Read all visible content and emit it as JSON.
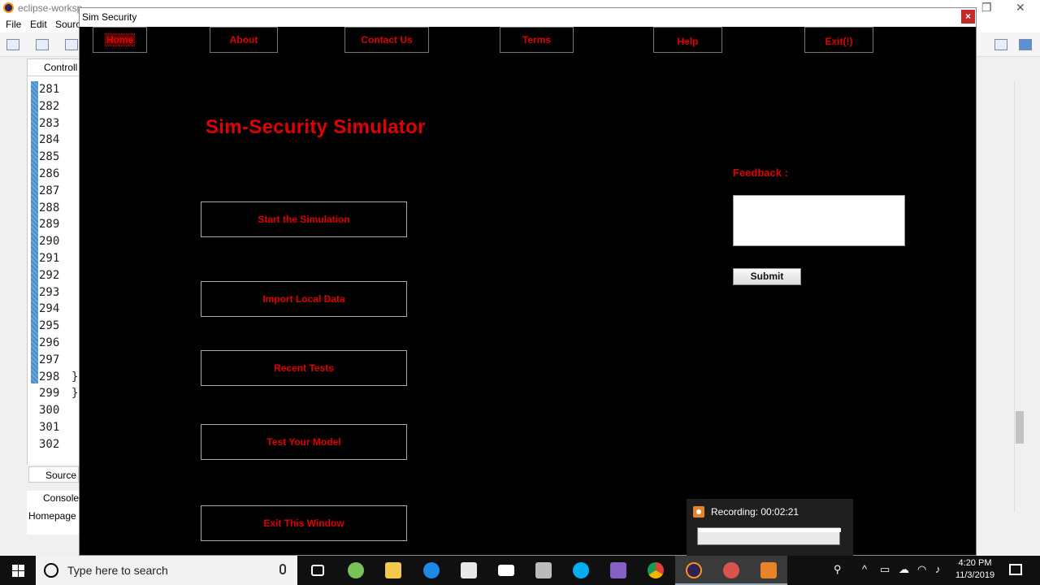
{
  "eclipse": {
    "title": "eclipse-worksp",
    "menu": [
      "File",
      "Edit",
      "Sourc"
    ],
    "editor_tab": "Controll",
    "line_numbers": [
      "281",
      "282",
      "283",
      "284",
      "285",
      "286",
      "287",
      "288",
      "289",
      "290",
      "291",
      "292",
      "293",
      "294",
      "295",
      "296",
      "297",
      "298",
      "299",
      "300",
      "301",
      "302"
    ],
    "braces": {
      "298": "}",
      "299": "}"
    },
    "source_tab": "Source",
    "console_tab": "Console",
    "console_text": "Homepage ("
  },
  "app": {
    "window_title": "Sim Security",
    "close_glyph": "×",
    "nav": [
      {
        "label": "Home"
      },
      {
        "label": "About"
      },
      {
        "label": "Contact Us"
      },
      {
        "label": "Terms"
      },
      {
        "label": "Help"
      },
      {
        "label": "Exit(!)"
      }
    ],
    "title": "Sim-Security Simulator",
    "buttons": [
      {
        "label": "Start the Simulation"
      },
      {
        "label": "Import Local Data"
      },
      {
        "label": "Recent Tests"
      },
      {
        "label": "Test Your Model"
      },
      {
        "label": "Exit This Window"
      }
    ],
    "feedback": {
      "label": "Feedback :",
      "value": "",
      "submit_label": "Submit"
    }
  },
  "recording": {
    "label": "Recording:",
    "time": "00:02:21"
  },
  "taskbar": {
    "search_placeholder": "Type here to search",
    "time": "4:20 PM",
    "date": "11/3/2019"
  },
  "colors": {
    "app_background": "#000000",
    "app_accent": "#e00000",
    "taskbar": "#101010"
  }
}
